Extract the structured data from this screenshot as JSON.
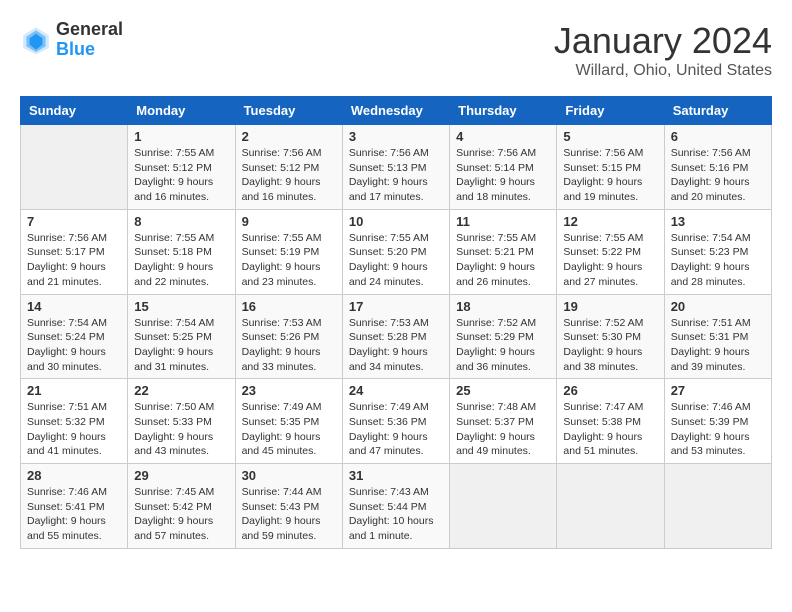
{
  "logo": {
    "general": "General",
    "blue": "Blue"
  },
  "title": "January 2024",
  "location": "Willard, Ohio, United States",
  "days_of_week": [
    "Sunday",
    "Monday",
    "Tuesday",
    "Wednesday",
    "Thursday",
    "Friday",
    "Saturday"
  ],
  "weeks": [
    [
      {
        "day": "",
        "empty": true
      },
      {
        "day": "1",
        "sunrise": "7:55 AM",
        "sunset": "5:12 PM",
        "daylight": "9 hours and 16 minutes."
      },
      {
        "day": "2",
        "sunrise": "7:56 AM",
        "sunset": "5:12 PM",
        "daylight": "9 hours and 16 minutes."
      },
      {
        "day": "3",
        "sunrise": "7:56 AM",
        "sunset": "5:13 PM",
        "daylight": "9 hours and 17 minutes."
      },
      {
        "day": "4",
        "sunrise": "7:56 AM",
        "sunset": "5:14 PM",
        "daylight": "9 hours and 18 minutes."
      },
      {
        "day": "5",
        "sunrise": "7:56 AM",
        "sunset": "5:15 PM",
        "daylight": "9 hours and 19 minutes."
      },
      {
        "day": "6",
        "sunrise": "7:56 AM",
        "sunset": "5:16 PM",
        "daylight": "9 hours and 20 minutes."
      }
    ],
    [
      {
        "day": "7",
        "sunrise": "7:56 AM",
        "sunset": "5:17 PM",
        "daylight": "9 hours and 21 minutes."
      },
      {
        "day": "8",
        "sunrise": "7:55 AM",
        "sunset": "5:18 PM",
        "daylight": "9 hours and 22 minutes."
      },
      {
        "day": "9",
        "sunrise": "7:55 AM",
        "sunset": "5:19 PM",
        "daylight": "9 hours and 23 minutes."
      },
      {
        "day": "10",
        "sunrise": "7:55 AM",
        "sunset": "5:20 PM",
        "daylight": "9 hours and 24 minutes."
      },
      {
        "day": "11",
        "sunrise": "7:55 AM",
        "sunset": "5:21 PM",
        "daylight": "9 hours and 26 minutes."
      },
      {
        "day": "12",
        "sunrise": "7:55 AM",
        "sunset": "5:22 PM",
        "daylight": "9 hours and 27 minutes."
      },
      {
        "day": "13",
        "sunrise": "7:54 AM",
        "sunset": "5:23 PM",
        "daylight": "9 hours and 28 minutes."
      }
    ],
    [
      {
        "day": "14",
        "sunrise": "7:54 AM",
        "sunset": "5:24 PM",
        "daylight": "9 hours and 30 minutes."
      },
      {
        "day": "15",
        "sunrise": "7:54 AM",
        "sunset": "5:25 PM",
        "daylight": "9 hours and 31 minutes."
      },
      {
        "day": "16",
        "sunrise": "7:53 AM",
        "sunset": "5:26 PM",
        "daylight": "9 hours and 33 minutes."
      },
      {
        "day": "17",
        "sunrise": "7:53 AM",
        "sunset": "5:28 PM",
        "daylight": "9 hours and 34 minutes."
      },
      {
        "day": "18",
        "sunrise": "7:52 AM",
        "sunset": "5:29 PM",
        "daylight": "9 hours and 36 minutes."
      },
      {
        "day": "19",
        "sunrise": "7:52 AM",
        "sunset": "5:30 PM",
        "daylight": "9 hours and 38 minutes."
      },
      {
        "day": "20",
        "sunrise": "7:51 AM",
        "sunset": "5:31 PM",
        "daylight": "9 hours and 39 minutes."
      }
    ],
    [
      {
        "day": "21",
        "sunrise": "7:51 AM",
        "sunset": "5:32 PM",
        "daylight": "9 hours and 41 minutes."
      },
      {
        "day": "22",
        "sunrise": "7:50 AM",
        "sunset": "5:33 PM",
        "daylight": "9 hours and 43 minutes."
      },
      {
        "day": "23",
        "sunrise": "7:49 AM",
        "sunset": "5:35 PM",
        "daylight": "9 hours and 45 minutes."
      },
      {
        "day": "24",
        "sunrise": "7:49 AM",
        "sunset": "5:36 PM",
        "daylight": "9 hours and 47 minutes."
      },
      {
        "day": "25",
        "sunrise": "7:48 AM",
        "sunset": "5:37 PM",
        "daylight": "9 hours and 49 minutes."
      },
      {
        "day": "26",
        "sunrise": "7:47 AM",
        "sunset": "5:38 PM",
        "daylight": "9 hours and 51 minutes."
      },
      {
        "day": "27",
        "sunrise": "7:46 AM",
        "sunset": "5:39 PM",
        "daylight": "9 hours and 53 minutes."
      }
    ],
    [
      {
        "day": "28",
        "sunrise": "7:46 AM",
        "sunset": "5:41 PM",
        "daylight": "9 hours and 55 minutes."
      },
      {
        "day": "29",
        "sunrise": "7:45 AM",
        "sunset": "5:42 PM",
        "daylight": "9 hours and 57 minutes."
      },
      {
        "day": "30",
        "sunrise": "7:44 AM",
        "sunset": "5:43 PM",
        "daylight": "9 hours and 59 minutes."
      },
      {
        "day": "31",
        "sunrise": "7:43 AM",
        "sunset": "5:44 PM",
        "daylight": "10 hours and 1 minute."
      },
      {
        "day": "",
        "empty": true
      },
      {
        "day": "",
        "empty": true
      },
      {
        "day": "",
        "empty": true
      }
    ]
  ]
}
